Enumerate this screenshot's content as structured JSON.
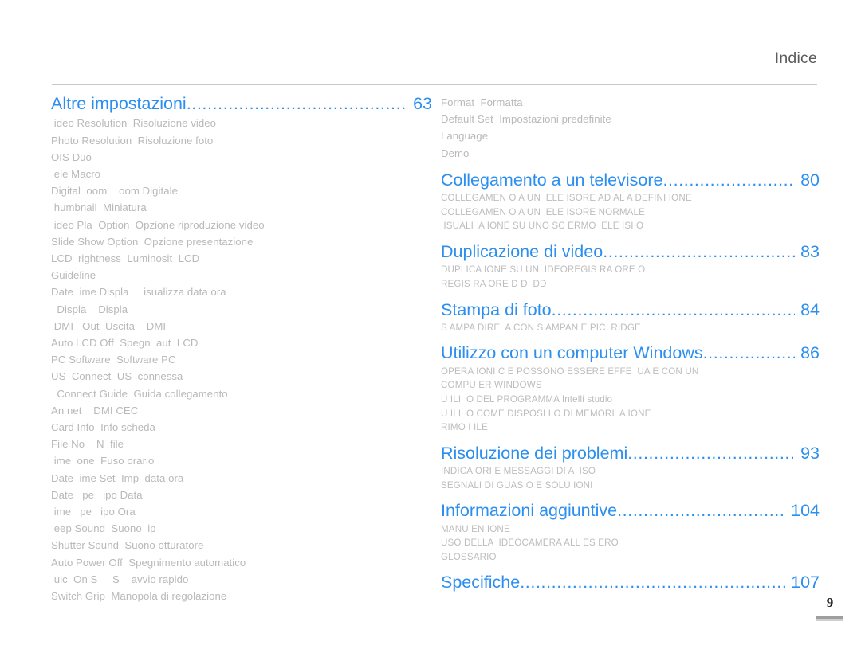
{
  "header": {
    "title": "Indice"
  },
  "folio": {
    "page_number": "9"
  },
  "leader": "...........................................................................................",
  "columns": {
    "left": [
      {
        "type": "chapter",
        "title": "Altre impostazioni",
        "page": "63",
        "subitems": [
          " ideo Resolution  Risoluzione video",
          "Photo Resolution  Risoluzione foto",
          "OIS Duo",
          " ele Macro",
          "Digital  oom    oom Digitale",
          " humbnail  Miniatura",
          " ideo Pla  Option  Opzione riproduzione video",
          "Slide Show Option  Opzione presentazione",
          "LCD  rightness  Luminosit  LCD",
          "Guideline",
          "Date  ime Displa     isualizza data ora",
          "  Displa    Displa",
          " DMI   Out  Uscita    DMI",
          "Auto LCD Off  Spegn  aut  LCD",
          "PC Software  Software PC",
          "US  Connect  US  connessa",
          "  Connect Guide  Guida collegamento",
          "An net    DMI CEC",
          "Card Info  Info scheda",
          "File No    N  file",
          " ime  one  Fuso orario",
          "Date  ime Set  Imp  data ora",
          "Date   pe   ipo Data",
          " ime   pe   ipo Ora",
          " eep Sound  Suono  ip",
          "Shutter Sound  Suono otturatore",
          "Auto Power Off  Spegnimento automatico",
          " uic  On S     S    avvio rapido",
          "Switch Grip  Manopola di regolazione"
        ]
      }
    ],
    "right": [
      {
        "type": "orphan-subitems",
        "subitems": [
          "Format  Formatta",
          "Default Set  Impostazioni predefinite",
          "Language",
          "Demo"
        ]
      },
      {
        "type": "chapter",
        "title": "Collegamento a un televisore",
        "page": "80",
        "caps": true,
        "subitems": [
          "COLLEGAMEN O A UN  ELE ISORE AD AL A DEFINI IONE",
          "COLLEGAMEN O A UN  ELE ISORE NORMALE",
          " ISUALI  A IONE SU UNO SC ERMO  ELE ISI O"
        ]
      },
      {
        "type": "chapter",
        "title": "Duplicazione di video",
        "page": "83",
        "caps": true,
        "subitems": [
          "DUPLICA IONE SU UN  IDEOREGIS RA ORE O",
          "REGIS RA ORE D D  DD"
        ]
      },
      {
        "type": "chapter",
        "title": "Stampa di foto",
        "page": "84",
        "caps": true,
        "subitems": [
          "S AMPA DIRE  A CON S AMPAN E PIC  RIDGE"
        ]
      },
      {
        "type": "chapter",
        "title": "Utilizzo con un computer Windows",
        "page": "86",
        "caps": true,
        "subitems": [
          "OPERA IONI C E POSSONO ESSERE EFFE  UA E CON UN",
          "COMPU ER WINDOWS",
          "U ILI  O DEL PROGRAMMA Intelli studio",
          "U ILI  O COME DISPOSI I O DI MEMORI  A IONE",
          "RIMO I ILE"
        ]
      },
      {
        "type": "chapter",
        "title": "Risoluzione dei problemi",
        "page": "93",
        "caps": true,
        "subitems": [
          "INDICA ORI E MESSAGGI DI A  ISO",
          "SEGNALI DI GUAS O E SOLU IONI"
        ]
      },
      {
        "type": "chapter",
        "title": "Informazioni aggiuntive",
        "page": "104",
        "caps": true,
        "subitems": [
          "MANU EN IONE",
          "USO DELLA  IDEOCAMERA ALL ES ERO",
          "GLOSSARIO"
        ]
      },
      {
        "type": "chapter",
        "title": "Specifiche",
        "page": "107",
        "caps": true,
        "subitems": []
      }
    ]
  },
  "colors": {
    "accent": "#2b8ff0",
    "subitem_text": "#b9b9b9",
    "header_text": "#5c5c5c",
    "rule": "#8a8a8a"
  }
}
